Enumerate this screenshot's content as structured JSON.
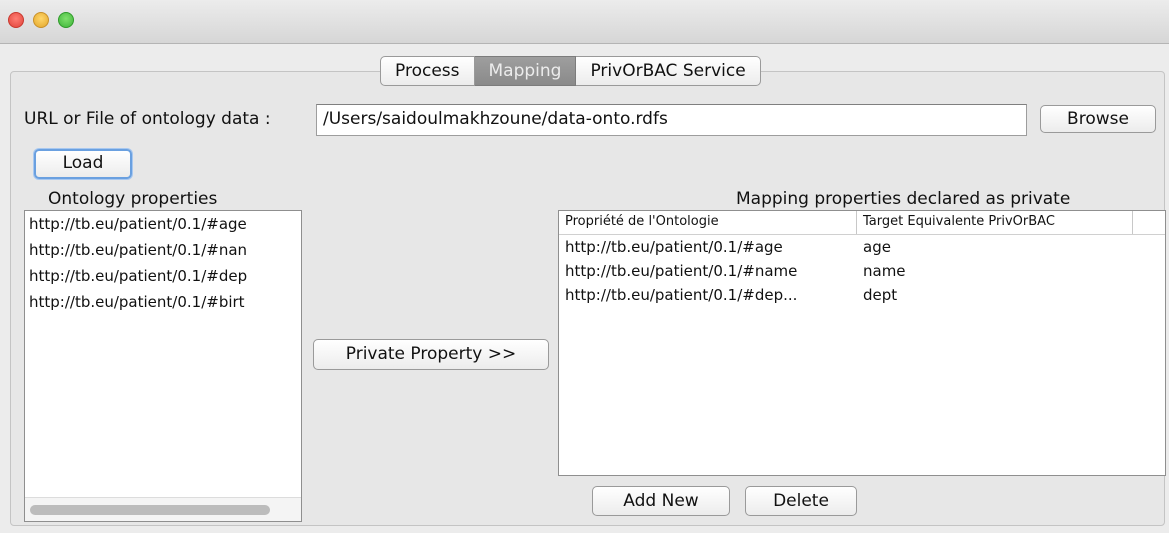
{
  "window": {
    "traffic_lights": [
      "close",
      "minimize",
      "maximize"
    ],
    "colors": {
      "close": "#e0443b",
      "minimize": "#e3a72a",
      "maximize": "#3fb43a",
      "active_tab": "#8e8e8e"
    }
  },
  "tabs": [
    {
      "label": "Process",
      "active": false
    },
    {
      "label": "Mapping",
      "active": true
    },
    {
      "label": "PrivOrBAC Service",
      "active": false
    }
  ],
  "source": {
    "label": "URL or File of ontology data :",
    "value": "/Users/saidoulmakhzoune/data-onto.rdfs",
    "browse_label": "Browse",
    "load_label": "Load"
  },
  "ontology": {
    "title": "Ontology properties",
    "items": [
      "http://tb.eu/patient/0.1/#age",
      "http://tb.eu/patient/0.1/#nan",
      "http://tb.eu/patient/0.1/#dep",
      "http://tb.eu/patient/0.1/#birt"
    ]
  },
  "private_button_label": "Private Property >>",
  "mapping": {
    "title": "Mapping properties declared as private",
    "columns": [
      "Propriété de l'Ontologie",
      "Target Equivalente PrivOrBAC"
    ],
    "rows": [
      [
        "http://tb.eu/patient/0.1/#age",
        "age"
      ],
      [
        "http://tb.eu/patient/0.1/#name",
        "name"
      ],
      [
        "http://tb.eu/patient/0.1/#dep...",
        "dept"
      ]
    ],
    "add_label": "Add New",
    "delete_label": "Delete"
  }
}
